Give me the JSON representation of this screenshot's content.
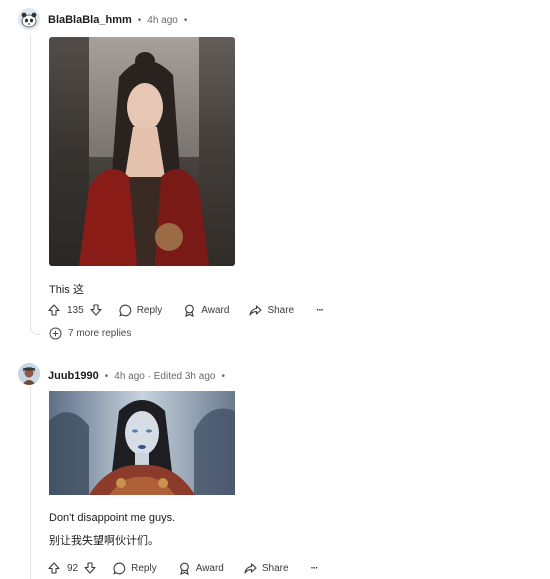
{
  "comments": [
    {
      "username": "BlaBlaBla_hmm",
      "meta": "4h ago",
      "text_lines": [
        "This 这"
      ],
      "image_alt": "woman with dark hair and red garment",
      "votes": "135",
      "actions": {
        "reply": "Reply",
        "award": "Award",
        "share": "Share",
        "more": "···"
      },
      "more_replies": "7 more replies"
    },
    {
      "username": "Juub1990",
      "meta": "4h ago · Edited 3h ago",
      "text_lines": [
        "Don't disappoint me guys.",
        "别让我失望啊伙计们。"
      ],
      "image_alt": "pale woman with blue lips and dark hair",
      "votes": "92",
      "actions": {
        "reply": "Reply",
        "award": "Award",
        "share": "Share",
        "more": "···"
      }
    }
  ],
  "colors": {
    "accent": "#ff4500",
    "text": "#1c1c1c",
    "meta": "#6a6a6a"
  }
}
